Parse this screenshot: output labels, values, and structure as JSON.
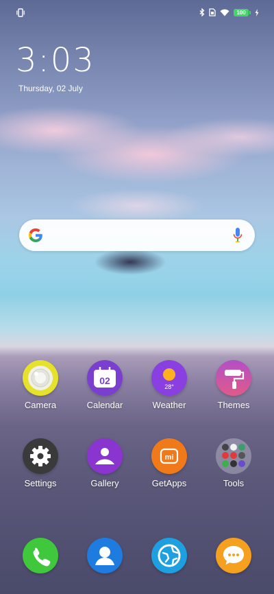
{
  "status_bar": {
    "battery_level": "100",
    "icons": [
      "vibrate-icon",
      "bluetooth-icon",
      "sim-icon",
      "wifi-icon",
      "battery-icon",
      "charging-icon"
    ]
  },
  "lockscreen": {
    "time": "3:03",
    "date": "Thursday, 02 July"
  },
  "search": {
    "provider_icon": "google-logo",
    "voice_icon": "mic-icon"
  },
  "apps_row1": [
    {
      "label": "Camera",
      "icon": "camera-icon",
      "color": "#e6e12a"
    },
    {
      "label": "Calendar",
      "icon": "calendar-icon",
      "color": "#7b3fd0",
      "icon_text": "02"
    },
    {
      "label": "Weather",
      "icon": "weather-icon",
      "color": "#8a3fe0",
      "icon_text": "28°"
    },
    {
      "label": "Themes",
      "icon": "themes-icon",
      "color": "#c94fb5"
    }
  ],
  "apps_row2": [
    {
      "label": "Settings",
      "icon": "settings-icon",
      "color": "#3a3a3a"
    },
    {
      "label": "Gallery",
      "icon": "gallery-icon",
      "color": "#8a35d0"
    },
    {
      "label": "GetApps",
      "icon": "getapps-icon",
      "color": "#f07a1a",
      "icon_text": "mi"
    },
    {
      "label": "Tools",
      "icon": "tools-folder-icon"
    }
  ],
  "dock": [
    {
      "icon": "phone-icon",
      "color": "#3fc83c"
    },
    {
      "icon": "contacts-icon",
      "color": "#1e7be0"
    },
    {
      "icon": "browser-icon",
      "color": "#1ea0e0"
    },
    {
      "icon": "messaging-icon",
      "color": "#f5a01e"
    }
  ]
}
